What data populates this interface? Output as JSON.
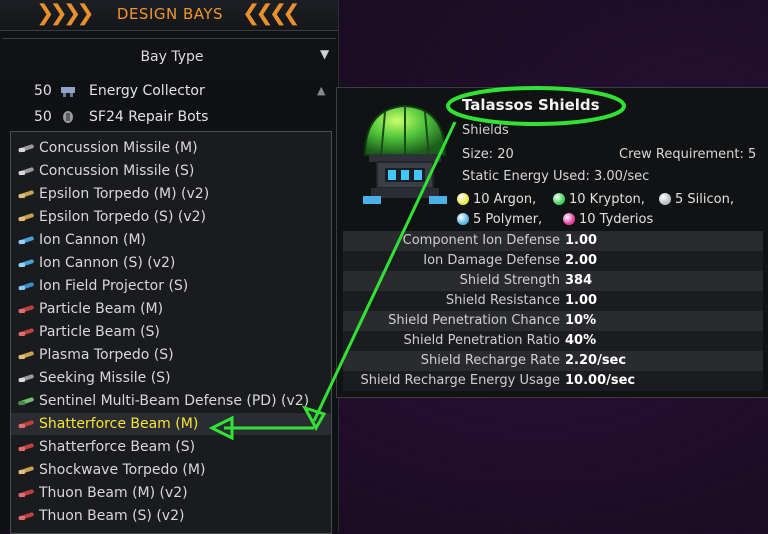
{
  "panel": {
    "title": "DESIGN BAYS",
    "bay_type": "Bay Type",
    "bays": [
      {
        "count": "50",
        "name": "Energy Collector"
      },
      {
        "count": "50",
        "name": "SF24 Repair Bots"
      }
    ]
  },
  "dropdown": {
    "items": [
      {
        "label": "Concussion Missile (M)",
        "icon": "missile-icon"
      },
      {
        "label": "Concussion Missile (S)",
        "icon": "missile-icon"
      },
      {
        "label": "Epsilon Torpedo (M) (v2)",
        "icon": "torpedo-icon"
      },
      {
        "label": "Epsilon Torpedo (S) (v2)",
        "icon": "torpedo-icon"
      },
      {
        "label": "Ion Cannon (M)",
        "icon": "cannon-icon"
      },
      {
        "label": "Ion Cannon (S) (v2)",
        "icon": "cannon-icon"
      },
      {
        "label": "Ion Field Projector (S)",
        "icon": "projector-icon"
      },
      {
        "label": "Particle Beam (M)",
        "icon": "beam-icon"
      },
      {
        "label": "Particle Beam (S)",
        "icon": "beam-icon"
      },
      {
        "label": "Plasma Torpedo (S)",
        "icon": "torpedo-icon"
      },
      {
        "label": "Seeking Missile (S)",
        "icon": "missile-icon"
      },
      {
        "label": "Sentinel Multi-Beam Defense (PD) (v2)",
        "icon": "defense-icon"
      },
      {
        "label": "Shatterforce Beam (M)",
        "icon": "beam-icon",
        "selected": true
      },
      {
        "label": "Shatterforce Beam (S)",
        "icon": "beam-icon"
      },
      {
        "label": "Shockwave Torpedo (M)",
        "icon": "torpedo-icon"
      },
      {
        "label": "Thuon Beam (M) (v2)",
        "icon": "beam-icon"
      },
      {
        "label": "Thuon Beam (S) (v2)",
        "icon": "beam-icon"
      }
    ]
  },
  "tooltip": {
    "title": "Talassos Shields",
    "category": "Shields",
    "size": "Size: 20",
    "crew": "Crew Requirement: 5",
    "static_energy": "Static Energy Used: 3.00/sec",
    "resources": [
      {
        "text": "10 Argon,",
        "color": "#e8e84a"
      },
      {
        "text": "10 Krypton,",
        "color": "#3fd35a"
      },
      {
        "text": "5 Silicon,",
        "color": "#b9c0c8"
      },
      {
        "text": "5 Polymer,",
        "color": "#5ab8e8"
      },
      {
        "text": "10 Tyderios",
        "color": "#e83fa0"
      }
    ],
    "stats": [
      {
        "label": "Component Ion Defense",
        "value": "1.00"
      },
      {
        "label": "Ion Damage Defense",
        "value": "2.00"
      },
      {
        "label": "Shield Strength",
        "value": "384"
      },
      {
        "label": "Shield Resistance",
        "value": "1.00"
      },
      {
        "label": "Shield Penetration Chance",
        "value": "10%"
      },
      {
        "label": "Shield Penetration Ratio",
        "value": "40%"
      },
      {
        "label": "Shield Recharge Rate",
        "value": "2.20/sec"
      },
      {
        "label": "Shield Recharge Energy Usage",
        "value": "10.00/sec"
      }
    ]
  },
  "colors": {
    "accent": "#f0962e",
    "highlight": "#f4e634",
    "annotation": "#31e234"
  }
}
